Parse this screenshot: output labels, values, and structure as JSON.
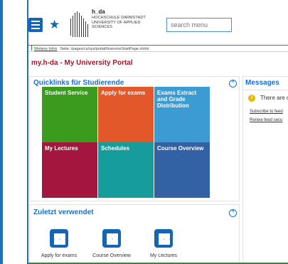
{
  "header": {
    "logo_name": "h_da",
    "logo_line1": "HOCHSCHULE DARMSTADT",
    "logo_line2": "UNIVERSITY OF APPLIED SCIENCES",
    "search_placeholder": "search menu",
    "brand_color": "#1565b5"
  },
  "info_bar": {
    "link": "Weitere Infos",
    "page_label": "Seite: /pages/cs/sys/portal/hisinoneStartPage.xhtml"
  },
  "portal_title": "my.h-da - My University Portal",
  "quicklinks": {
    "title": "Quicklinks für Studierende",
    "tiles": [
      {
        "label": "Student Service",
        "color": "#3a9b1f"
      },
      {
        "label": "Apply for exams",
        "color": "#e3582b"
      },
      {
        "label": "Exams Extract and Grade Distribution",
        "color": "#3d9bd3"
      },
      {
        "label": "My Lectures",
        "color": "#a3163e"
      },
      {
        "label": "Schedules",
        "color": "#159c9b"
      },
      {
        "label": "Course Overview",
        "color": "#3262a3"
      }
    ]
  },
  "messages": {
    "title": "Messages",
    "warning": "There are o",
    "link1": "Subscribe to feed",
    "link2": "Renew feed secu"
  },
  "recent": {
    "title": "Zuletzt verwendet",
    "items": [
      {
        "label": "Apply for exams"
      },
      {
        "label": "Course Overview"
      },
      {
        "label": "My Lectures"
      }
    ]
  },
  "icons": {
    "menu": "hamburger-icon",
    "favorite": "star-icon",
    "collapse": "chevron-up-circle-icon",
    "warning": "info-warning-icon",
    "app_tile": "grid-tile-icon"
  }
}
